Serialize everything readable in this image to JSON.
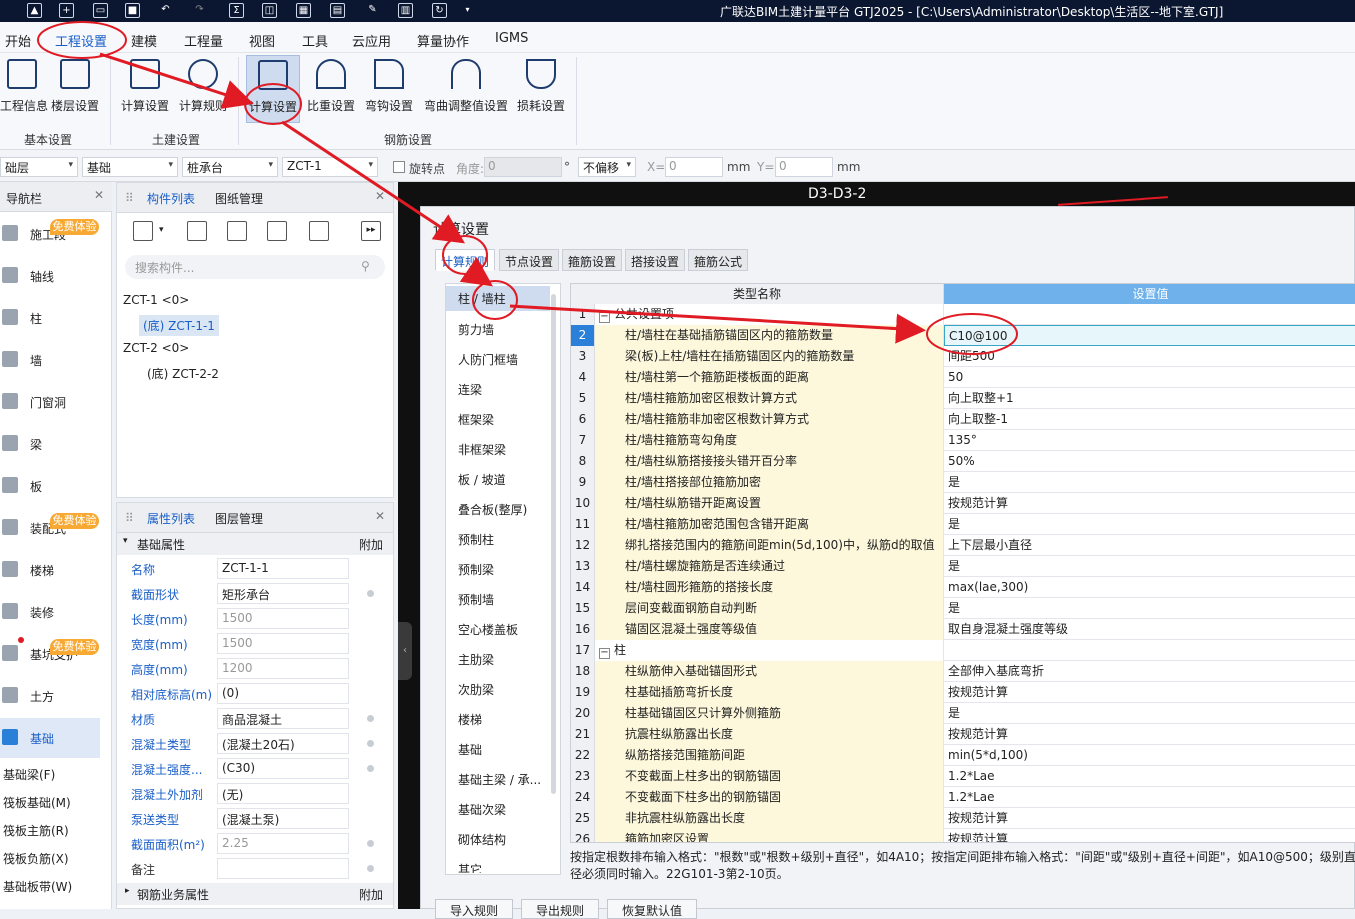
{
  "app_title": "广联达BIM土建计量平台 GTJ2025 - [C:\\Users\\Administrator\\Desktop\\生活区--地下室.GTJ]",
  "menu": [
    "开始",
    "工程设置",
    "建模",
    "工程量",
    "视图",
    "工具",
    "云应用",
    "算量协作",
    "IGMS"
  ],
  "ribbon": {
    "buttons": [
      "工程信息",
      "楼层设置",
      "计算设置",
      "计算规则",
      "计算设置",
      "比重设置",
      "弯钩设置",
      "弯曲调整值设置",
      "损耗设置"
    ],
    "groups": [
      "基本设置",
      "土建设置",
      "钢筋设置"
    ]
  },
  "toolbar": {
    "floor": "础层",
    "category": "基础",
    "type": "桩承台",
    "element": "ZCT-1",
    "rotate_label": "旋转点",
    "angle_label": "角度:",
    "angle_value": "0",
    "degree_unit": "°",
    "offset": "不偏移",
    "x_label": "X=",
    "x_value": "0",
    "y_label": "Y=",
    "y_value": "0",
    "mm": "mm"
  },
  "nav": {
    "title": "导航栏",
    "items": [
      "施工段",
      "轴线",
      "柱",
      "墙",
      "门窗洞",
      "梁",
      "板",
      "装配式",
      "楼梯",
      "装修",
      "基坑支护",
      "土方",
      "基础"
    ],
    "badge": "免费体验",
    "subitems": [
      "基础梁(F)",
      "筏板基础(M)",
      "筏板主筋(R)",
      "筏板负筋(X)",
      "基础板带(W)"
    ]
  },
  "component_panel": {
    "tabs": [
      "构件列表",
      "图纸管理"
    ],
    "search_placeholder": "搜索构件...",
    "tree": [
      "ZCT-1 <0>",
      "(底) ZCT-1-1",
      "ZCT-2 <0>",
      "(底) ZCT-2-2"
    ]
  },
  "property_panel": {
    "tabs": [
      "属性列表",
      "图层管理"
    ],
    "group": "基础属性",
    "attach": "附加",
    "rows": [
      {
        "name": "名称",
        "value": "ZCT-1-1"
      },
      {
        "name": "截面形状",
        "value": "矩形承台"
      },
      {
        "name": "长度(mm)",
        "value": "1500"
      },
      {
        "name": "宽度(mm)",
        "value": "1500"
      },
      {
        "name": "高度(mm)",
        "value": "1200"
      },
      {
        "name": "相对底标高(m)",
        "value": "(0)"
      },
      {
        "name": "材质",
        "value": "商品混凝土"
      },
      {
        "name": "混凝土类型",
        "value": "(混凝土20石)"
      },
      {
        "name": "混凝土强度...",
        "value": "(C30)"
      },
      {
        "name": "混凝土外加剂",
        "value": "(无)"
      },
      {
        "name": "泵送类型",
        "value": "(混凝土泵)"
      },
      {
        "name": "截面面积(m²)",
        "value": "2.25"
      },
      {
        "name": "备注",
        "value": ""
      }
    ],
    "group2": "钢筋业务属性"
  },
  "canvas_label": "D3-D3-2",
  "dialog": {
    "title": "计算设置",
    "tabs": [
      "计算规则",
      "节点设置",
      "箍筋设置",
      "搭接设置",
      "箍筋公式"
    ],
    "left_items": [
      "柱 / 墙柱",
      "剪力墙",
      "人防门框墙",
      "连梁",
      "框架梁",
      "非框架梁",
      "板 / 坡道",
      "叠合板(整厚)",
      "预制柱",
      "预制梁",
      "预制墙",
      "空心楼盖板",
      "主肋梁",
      "次肋梁",
      "楼梯",
      "基础",
      "基础主梁 / 承...",
      "基础次梁",
      "砌体结构",
      "其它"
    ],
    "col_headers": [
      "类型名称",
      "设置值"
    ],
    "rows": [
      {
        "n": "1",
        "name": "公共设置项",
        "value": "",
        "group": true
      },
      {
        "n": "2",
        "name": "柱/墙柱在基础插筋锚固区内的箍筋数量",
        "value": "C10@100"
      },
      {
        "n": "3",
        "name": "梁(板)上柱/墙柱在插筋锚固区内的箍筋数量",
        "value": "间距500"
      },
      {
        "n": "4",
        "name": "柱/墙柱第一个箍筋距楼板面的距离",
        "value": "50"
      },
      {
        "n": "5",
        "name": "柱/墙柱箍筋加密区根数计算方式",
        "value": "向上取整+1"
      },
      {
        "n": "6",
        "name": "柱/墙柱箍筋非加密区根数计算方式",
        "value": "向上取整-1"
      },
      {
        "n": "7",
        "name": "柱/墙柱箍筋弯勾角度",
        "value": "135°"
      },
      {
        "n": "8",
        "name": "柱/墙柱纵筋搭接接头错开百分率",
        "value": "50%"
      },
      {
        "n": "9",
        "name": "柱/墙柱搭接部位箍筋加密",
        "value": "是"
      },
      {
        "n": "10",
        "name": "柱/墙柱纵筋错开距离设置",
        "value": "按规范计算"
      },
      {
        "n": "11",
        "name": "柱/墙柱箍筋加密范围包含错开距离",
        "value": "是"
      },
      {
        "n": "12",
        "name": "绑扎搭接范围内的箍筋间距min(5d,100)中，纵筋d的取值",
        "value": "上下层最小直径"
      },
      {
        "n": "13",
        "name": "柱/墙柱螺旋箍筋是否连续通过",
        "value": "是"
      },
      {
        "n": "14",
        "name": "柱/墙柱圆形箍筋的搭接长度",
        "value": "max(lae,300)"
      },
      {
        "n": "15",
        "name": "层间变截面钢筋自动判断",
        "value": "是"
      },
      {
        "n": "16",
        "name": "锚固区混凝土强度等级值",
        "value": "取自身混凝土强度等级"
      },
      {
        "n": "17",
        "name": "柱",
        "value": "",
        "group": true
      },
      {
        "n": "18",
        "name": "柱纵筋伸入基础锚固形式",
        "value": "全部伸入基底弯折"
      },
      {
        "n": "19",
        "name": "柱基础插筋弯折长度",
        "value": "按规范计算"
      },
      {
        "n": "20",
        "name": "柱基础锚固区只计算外侧箍筋",
        "value": "是"
      },
      {
        "n": "21",
        "name": "抗震柱纵筋露出长度",
        "value": "按规范计算"
      },
      {
        "n": "22",
        "name": "纵筋搭接范围箍筋间距",
        "value": "min(5*d,100)"
      },
      {
        "n": "23",
        "name": "不变截面上柱多出的钢筋锚固",
        "value": "1.2*Lae"
      },
      {
        "n": "24",
        "name": "不变截面下柱多出的钢筋锚固",
        "value": "1.2*Lae"
      },
      {
        "n": "25",
        "name": "非抗震柱纵筋露出长度",
        "value": "按规范计算"
      },
      {
        "n": "26",
        "name": "箍筋加密区设置",
        "value": "按规范计算"
      }
    ],
    "hint": "按指定根数排布输入格式：\"根数\"或\"根数+级别+直径\"，如4A10；按指定间距排布输入格式：\"间距\"或\"级别+直径+间距\"，如A10@500；级别直径必须同时输入。22G101-3第2-10页。",
    "buttons": [
      "导入规则",
      "导出规则",
      "恢复默认值"
    ]
  },
  "colors": {
    "accent": "#1a5fc8",
    "annotation": "#e01b24",
    "title_bar": "#0b1731"
  }
}
